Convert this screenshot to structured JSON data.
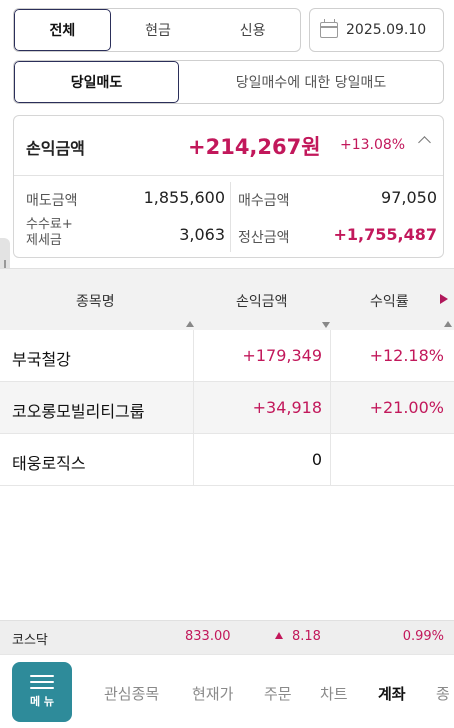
{
  "filter": {
    "options": [
      "전체",
      "현금",
      "신용"
    ],
    "active": "전체",
    "date": "2025.09.10"
  },
  "tradeType": {
    "active": "당일매도",
    "other": "당일매수에 대한 당일매도"
  },
  "summary": {
    "profit_label": "손익금액",
    "profit_value": "+214,267원",
    "profit_rate": "+13.08%",
    "sell_label": "매도금액",
    "sell_value": "1,855,600",
    "buy_label": "매수금액",
    "buy_value": "97,050",
    "fee_label_1": "수수료+",
    "fee_label_2": "제세금",
    "fee_value": "3,063",
    "settle_label": "정산금액",
    "settle_value": "+1,755,487"
  },
  "table": {
    "headers": [
      "종목명",
      "손익금액",
      "수익률"
    ],
    "rows": [
      {
        "name": "부국철강",
        "profit": "+179,349",
        "rate": "+12.18%"
      },
      {
        "name": "코오롱모빌리티그룹",
        "profit": "+34,918",
        "rate": "+21.00%"
      },
      {
        "name": "태웅로직스",
        "profit": "0",
        "rate": ""
      }
    ]
  },
  "ticker": {
    "name": "코스닥",
    "value": "833.00",
    "change": "8.18",
    "rate": "0.99%"
  },
  "nav": {
    "menu_label": "메 뉴",
    "items": [
      "관심종목",
      "현재가",
      "주문",
      "차트",
      "계좌",
      "종"
    ],
    "active": "계좌"
  },
  "colors": {
    "up": "#c2185b",
    "menu": "#2e8b9a",
    "active_border": "#2b2f5a"
  }
}
